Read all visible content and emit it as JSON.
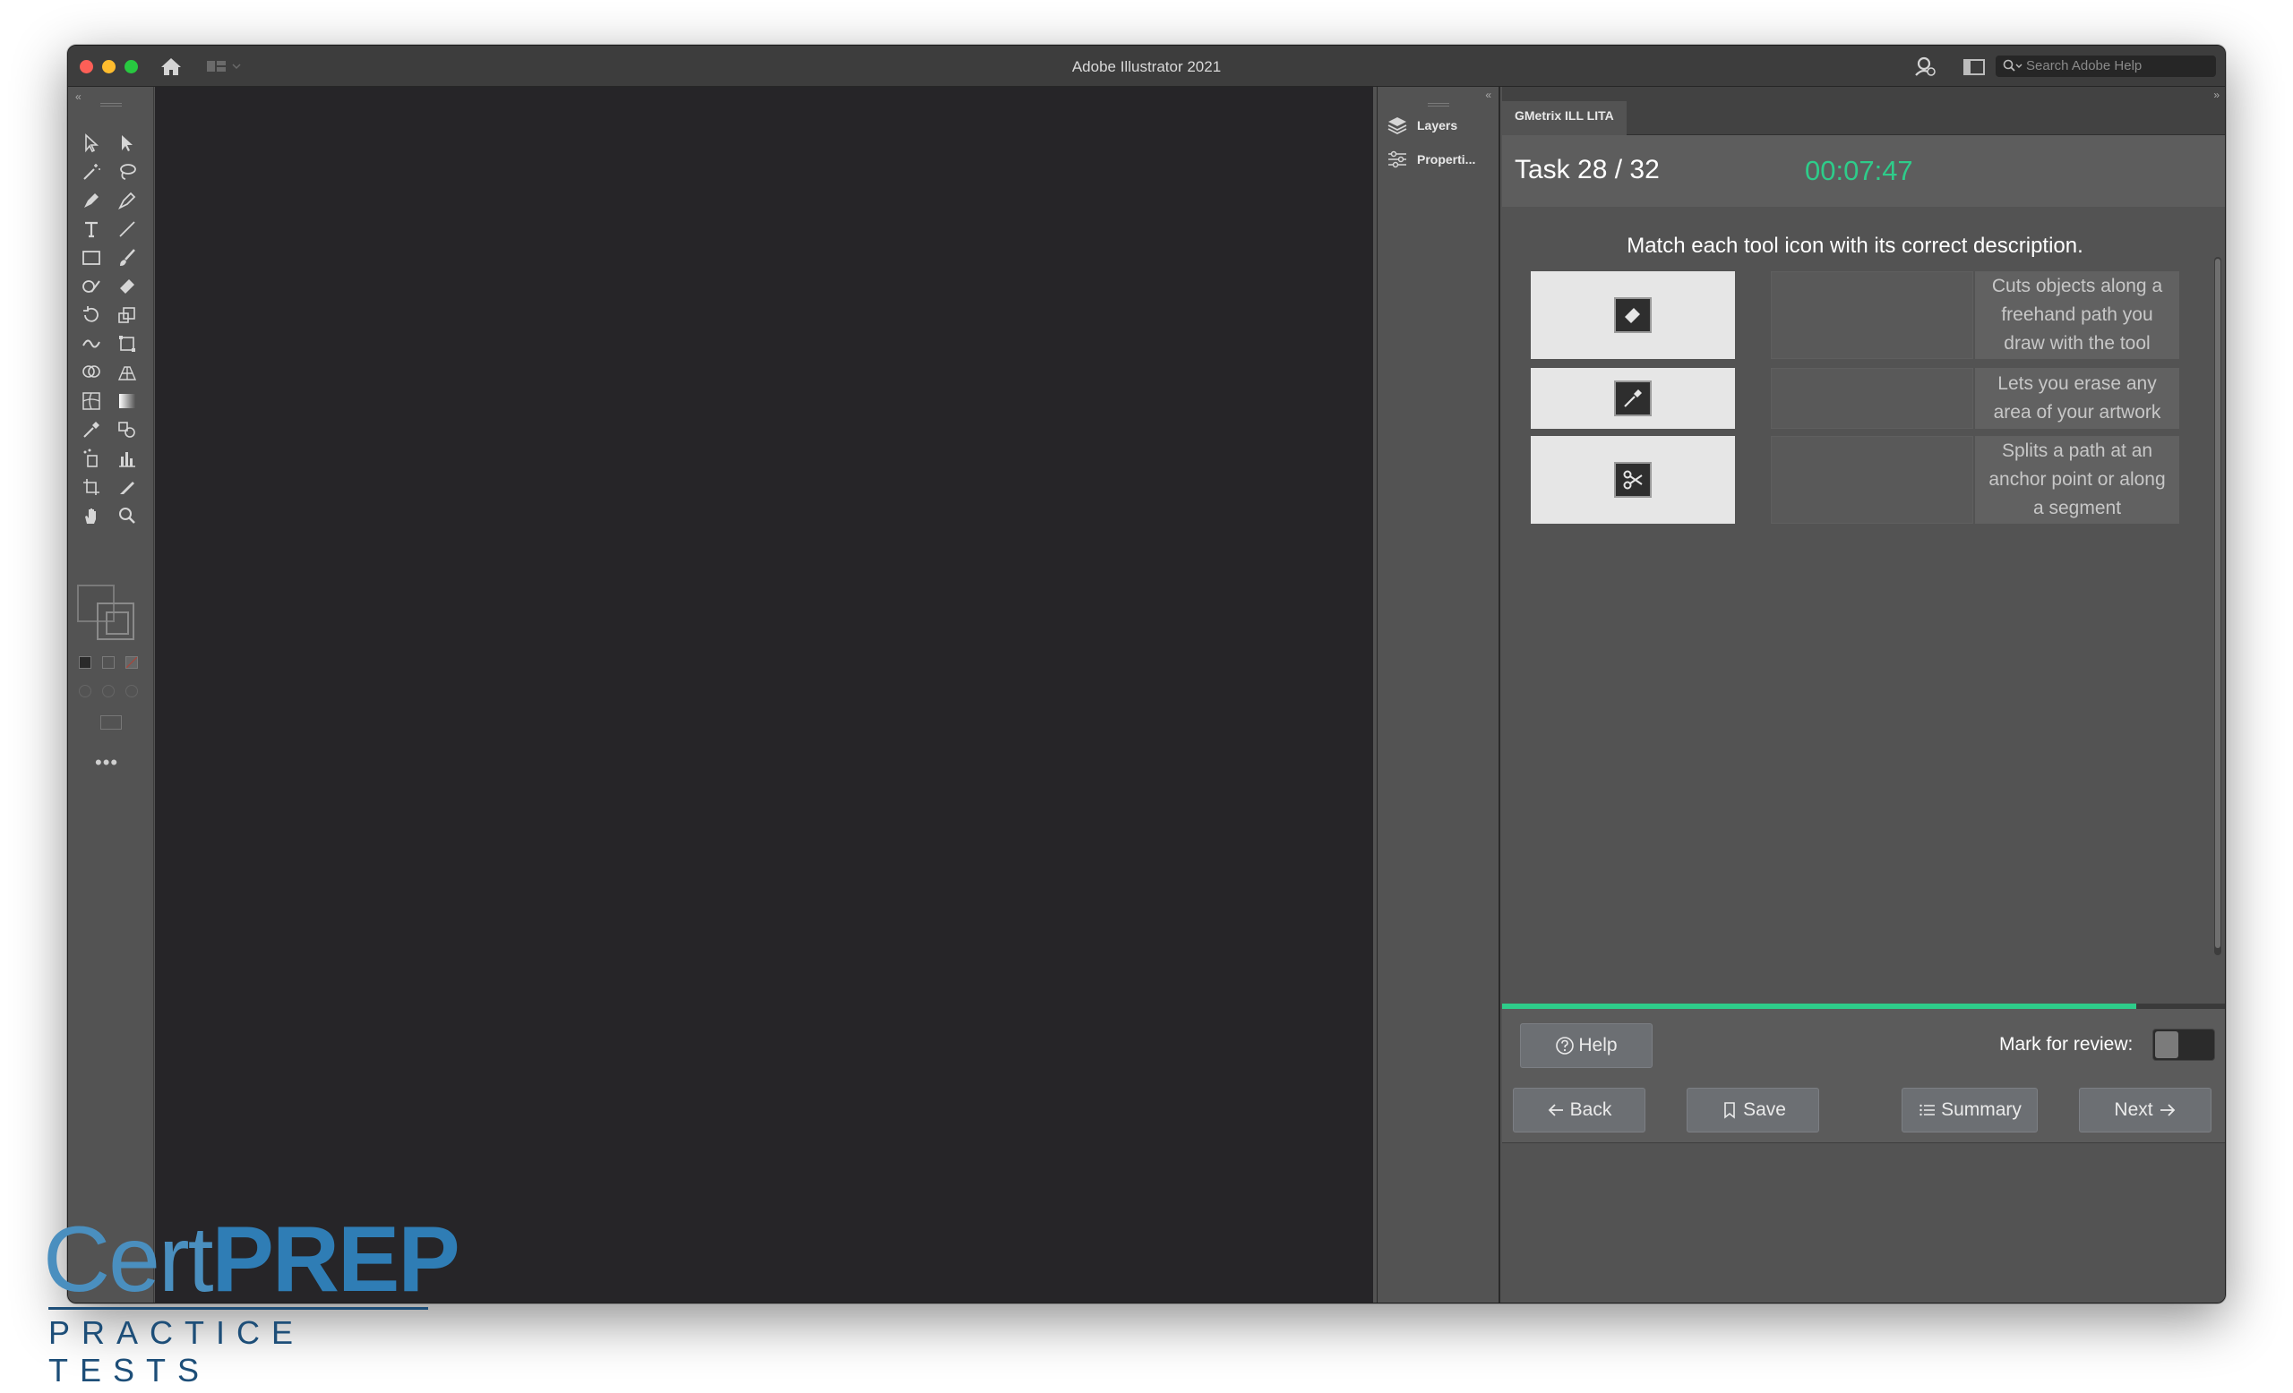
{
  "window": {
    "title": "Adobe Illustrator 2021",
    "search_placeholder": "Search Adobe Help"
  },
  "toolbar": {
    "collapse_glyph": "«",
    "more_glyph": "•••"
  },
  "dock": {
    "collapse_glyph": "«",
    "items": [
      {
        "label": "Layers",
        "icon": "layers-icon"
      },
      {
        "label": "Properti...",
        "icon": "properties-icon"
      }
    ]
  },
  "panel": {
    "tab_label": "GMetrix ILL LITA",
    "expand_glyph": "»",
    "task_label": "Task 28 / 32",
    "timer": "00:07:47",
    "instruction": "Match each tool icon with its correct description.",
    "tool_icons": [
      "eraser-tool-icon",
      "eyedropper-tool-icon",
      "scissors-tool-icon"
    ],
    "descriptions": [
      "Cuts objects along a freehand path you draw with the tool",
      "Lets you erase any area of your artwork",
      "Splits a path at an anchor point or along a segment"
    ],
    "progress_fraction": 0.875,
    "help_label": "Help",
    "mark_review_label": "Mark for review:",
    "mark_review_on": false,
    "back_label": "Back",
    "save_label": "Save",
    "summary_label": "Summary",
    "next_label": "Next"
  },
  "watermark": {
    "brand_light": "Cert",
    "brand_bold": "PREP",
    "tagline": "PRACTICE TESTS"
  },
  "colors": {
    "timer": "#2ecc8a",
    "progress": "#2ecc8a",
    "logo_blue": "#2f7db5",
    "logo_navy": "#1d4e78"
  }
}
